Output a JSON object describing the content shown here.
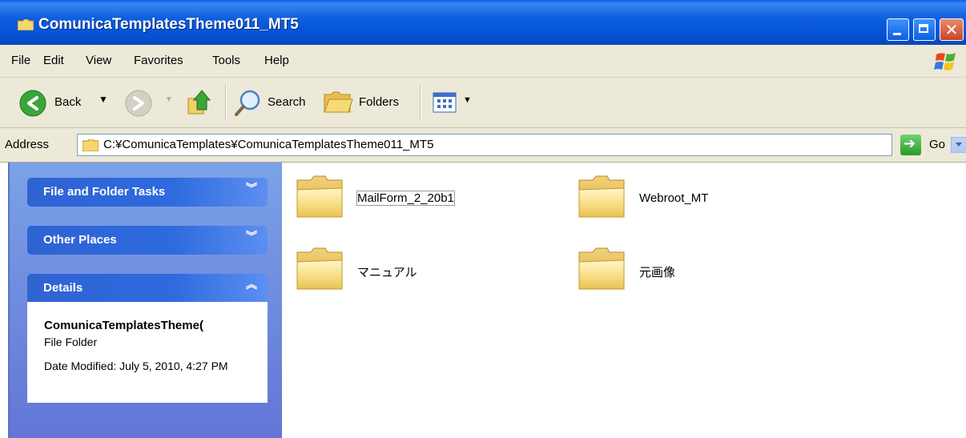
{
  "window": {
    "title": "ComunicaTemplatesTheme011_MT5"
  },
  "menu": {
    "items": [
      "File",
      "Edit",
      "View",
      "Favorites",
      "Tools",
      "Help"
    ]
  },
  "toolbar": {
    "back_label": "Back",
    "search_label": "Search",
    "folders_label": "Folders"
  },
  "address": {
    "label": "Address",
    "path": "C:¥ComunicaTemplates¥ComunicaTemplatesTheme011_MT5",
    "go_label": "Go"
  },
  "tasks": {
    "file_folder_tasks": "File and Folder Tasks",
    "other_places": "Other Places",
    "details": "Details",
    "details_name": "ComunicaTemplatesTheme(",
    "details_type": "File Folder",
    "details_modified": "Date Modified: July 5, 2010, 4:27 PM"
  },
  "files": [
    {
      "name": "MailForm_2_20b1",
      "selected": true
    },
    {
      "name": "Webroot_MT",
      "selected": false
    },
    {
      "name": "マニュアル",
      "selected": false
    },
    {
      "name": "元画像",
      "selected": false
    }
  ],
  "colors": {
    "titlebar": "#0553d8",
    "chrome": "#ece9d8",
    "taskpane": "#6f8fe0",
    "panel_header": "#2f63d2"
  }
}
